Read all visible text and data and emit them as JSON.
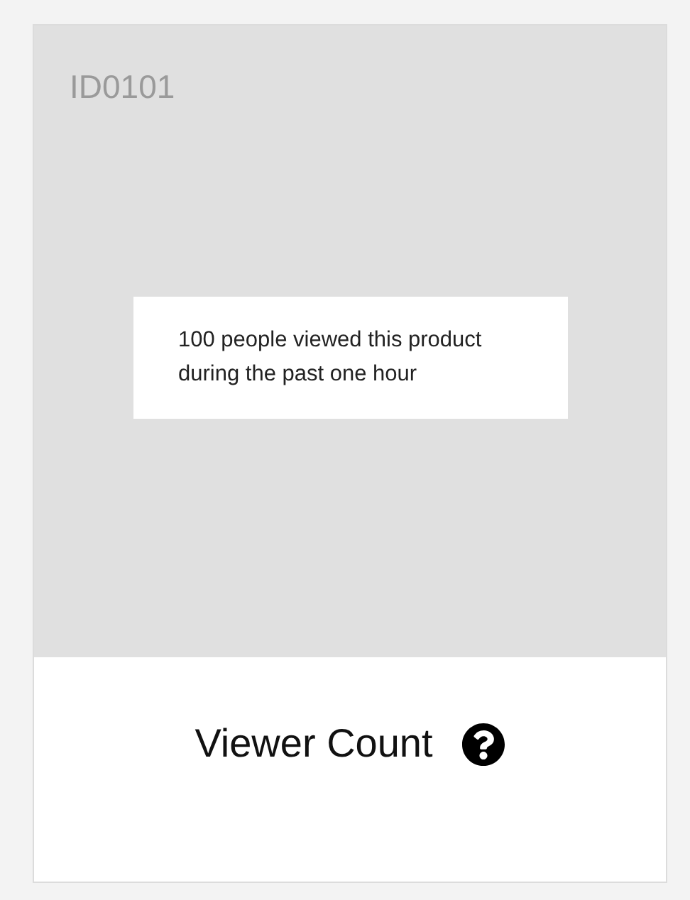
{
  "card": {
    "id_label": "ID0101",
    "message": "100 people viewed this product during the past one hour",
    "title": "Viewer Count"
  }
}
